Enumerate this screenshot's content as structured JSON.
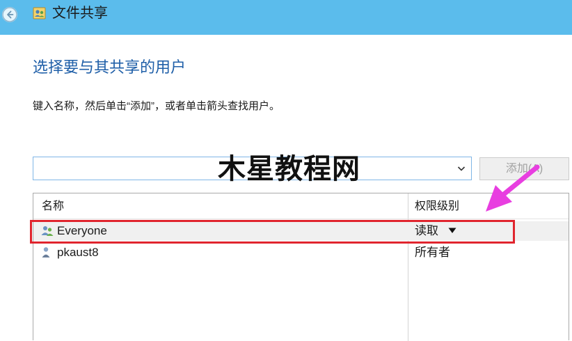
{
  "window": {
    "title": "文件共享",
    "back_icon": "back-arrow-icon",
    "app_icon": "users-share-icon",
    "titlebar_color": "#5bbcec"
  },
  "main": {
    "heading": "选择要与其共享的用户",
    "instruction": "键入名称，然后单击“添加”，或者单击箭头查找用户。",
    "name_input": {
      "value": "",
      "placeholder": ""
    },
    "add_button": "添加(A)"
  },
  "watermark": "木星教程网",
  "list": {
    "columns": [
      "名称",
      "权限级别"
    ],
    "rows": [
      {
        "name": "Everyone",
        "permission": "读取",
        "icon": "group-users-icon",
        "has_dropdown": true,
        "selected": true
      },
      {
        "name": "pkaust8",
        "permission": "所有者",
        "icon": "single-user-icon",
        "has_dropdown": false,
        "selected": false
      }
    ]
  },
  "annotations": {
    "highlight_color": "#e0252e",
    "arrow_color": "#e83ee0"
  }
}
